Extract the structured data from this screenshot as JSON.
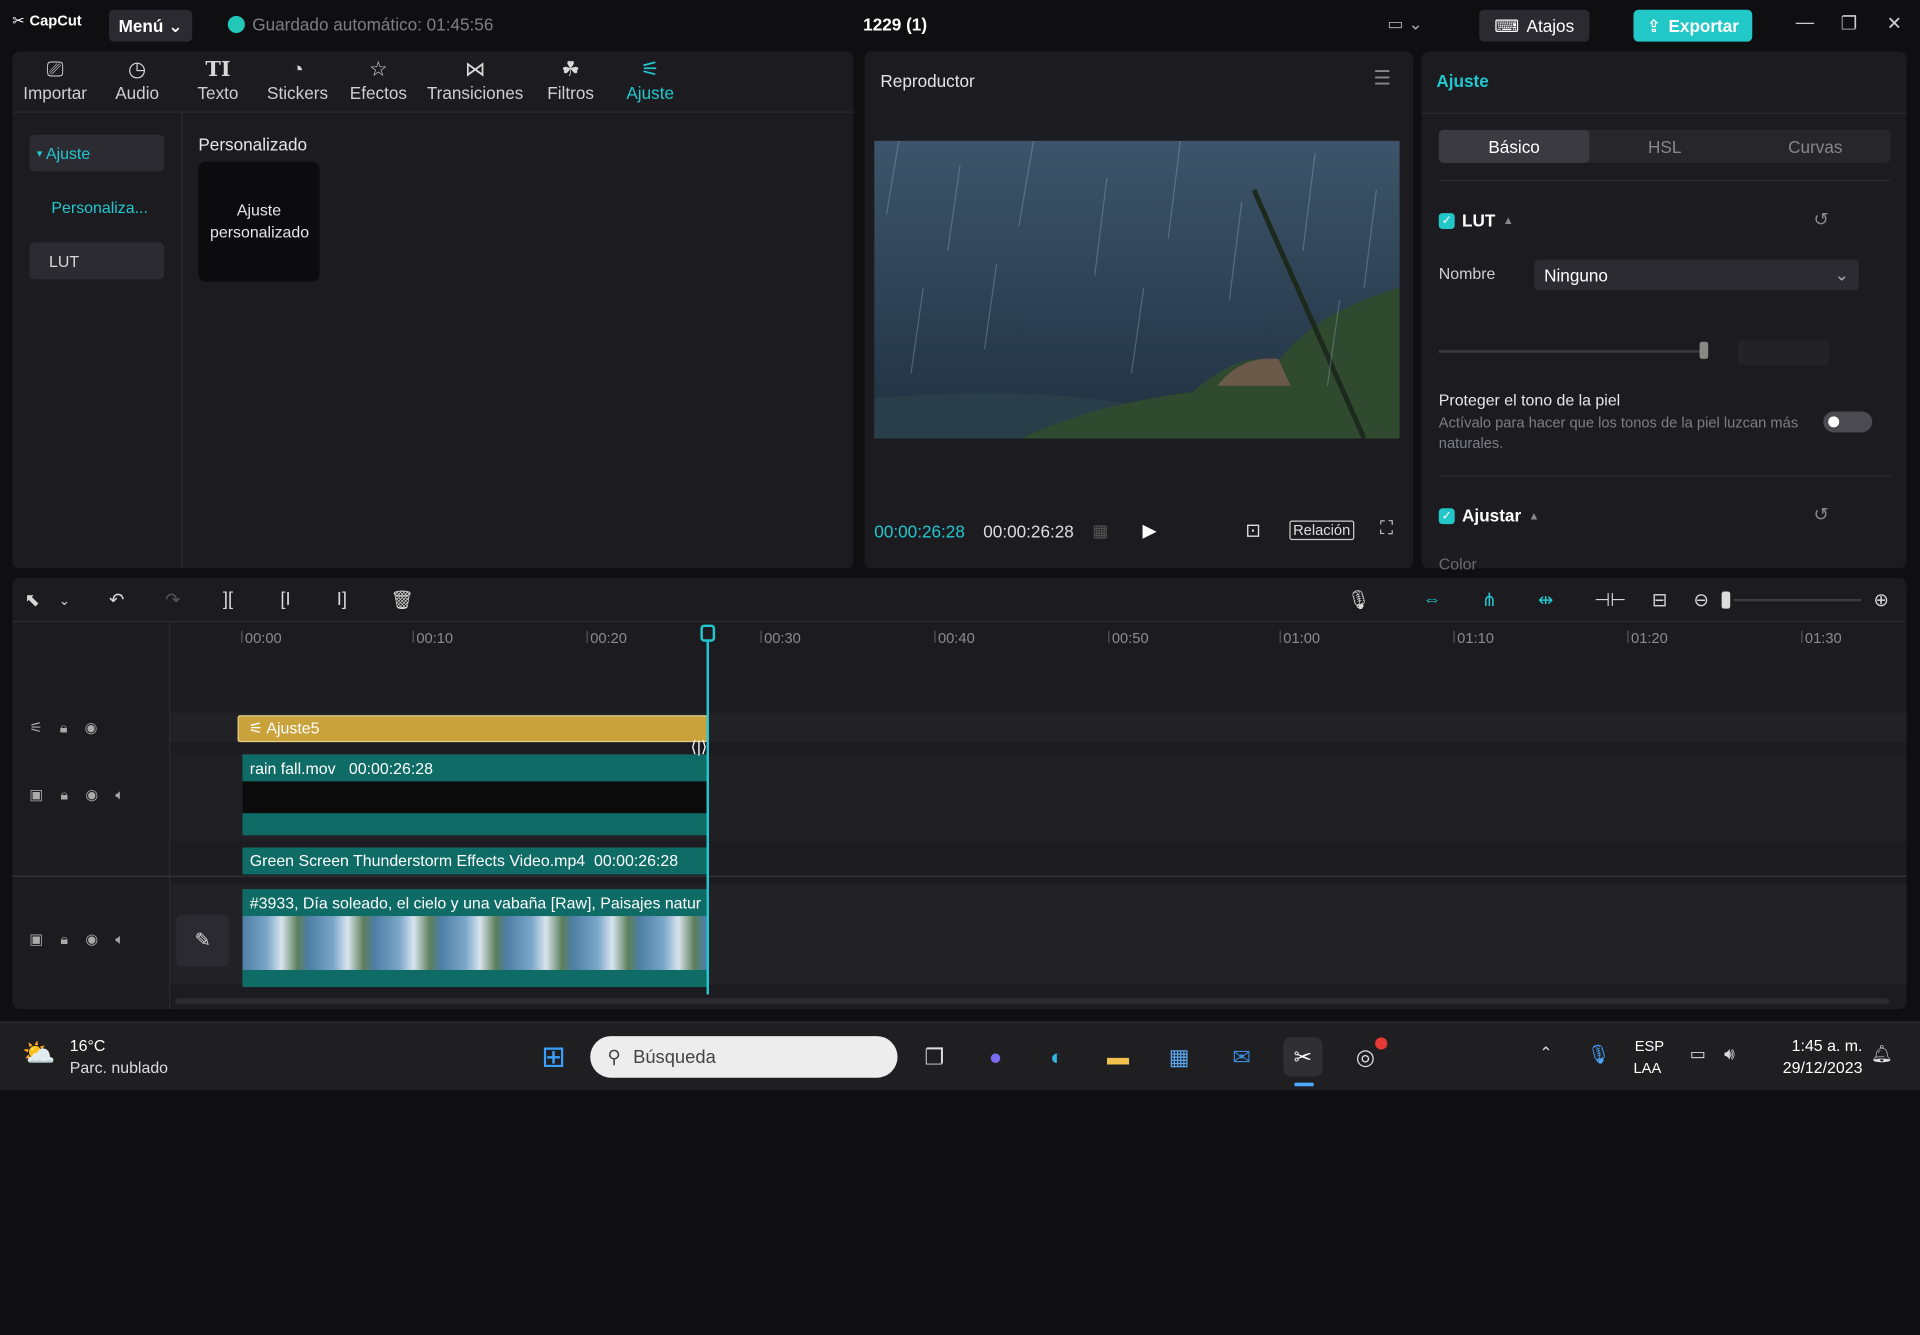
{
  "titlebar": {
    "logo": "CapCut",
    "menu": "Menú",
    "autosave": "Guardado automático: 01:45:56",
    "project": "1229 (1)",
    "shortcuts": "Atajos",
    "export": "Exportar"
  },
  "tool_tabs": [
    {
      "label": "Importar",
      "icon": "import-icon"
    },
    {
      "label": "Audio",
      "icon": "audio-icon"
    },
    {
      "label": "Texto",
      "icon": "text-icon"
    },
    {
      "label": "Stickers",
      "icon": "sticker-icon"
    },
    {
      "label": "Efectos",
      "icon": "effects-icon"
    },
    {
      "label": "Transiciones",
      "icon": "transitions-icon"
    },
    {
      "label": "Filtros",
      "icon": "filters-icon"
    },
    {
      "label": "Ajuste",
      "icon": "adjust-icon",
      "active": true
    }
  ],
  "sidebar": {
    "items": [
      "Ajuste",
      "Personaliza...",
      "LUT"
    ]
  },
  "media": {
    "section": "Personalizado",
    "card": "Ajuste personalizado"
  },
  "player": {
    "title": "Reproductor",
    "time_current": "00:00:26:28",
    "time_total": "00:00:26:28",
    "ratio": "Relación"
  },
  "adjust": {
    "title": "Ajuste",
    "tabs": [
      "Básico",
      "HSL",
      "Curvas"
    ],
    "lut_label": "LUT",
    "name_label": "Nombre",
    "name_value": "Ninguno",
    "skin_title": "Proteger el tono de la piel",
    "skin_desc": "Actívalo para hacer que los tonos de la piel luzcan más naturales.",
    "adjust_label": "Ajustar",
    "color_label": "Color"
  },
  "timeline": {
    "ruler": [
      "00:00",
      "00:10",
      "00:20",
      "00:30",
      "00:40",
      "00:50",
      "01:00",
      "01:10",
      "01:20",
      "01:30"
    ],
    "clips": {
      "adjust": "Ajuste5",
      "rain_name": "rain fall.mov",
      "rain_dur": "00:00:26:28",
      "green_name": "Green Screen Thunderstorm Effects Video.mp4",
      "green_dur": "00:00:26:28",
      "main_name": "#3933, Día soleado, el cielo y una vabaña [Raw], Paisajes natur"
    }
  },
  "taskbar": {
    "temp": "16°C",
    "weather": "Parc. nublado",
    "search": "Búsqueda",
    "lang1": "ESP",
    "lang2": "LAA",
    "time": "1:45 a. m.",
    "date": "29/12/2023"
  },
  "colors": {
    "accent": "#22c7d0",
    "adjust_clip": "#c9a23c",
    "video_clip": "#0f6b66"
  }
}
